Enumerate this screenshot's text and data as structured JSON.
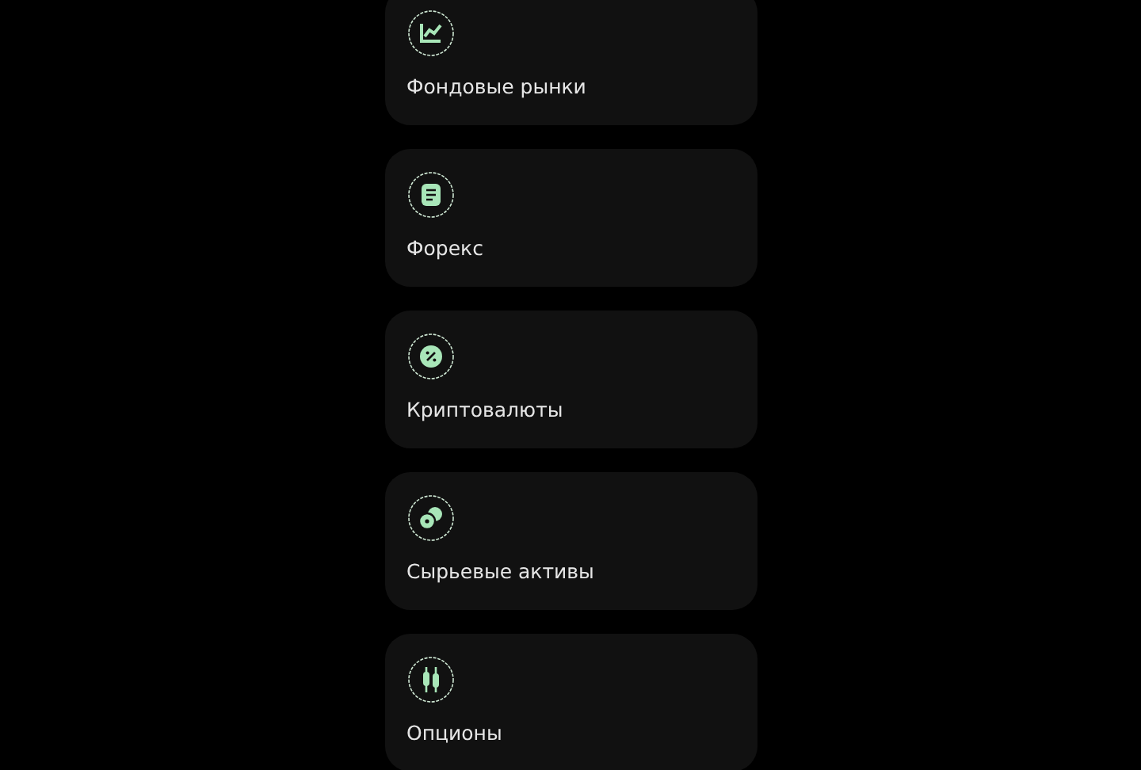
{
  "markets": [
    {
      "kind": "chart",
      "label": "Фондовые рынки"
    },
    {
      "kind": "document",
      "label": "Форекс"
    },
    {
      "kind": "percent",
      "label": "Криптовалюты"
    },
    {
      "kind": "coins",
      "label": "Сырьевые активы"
    },
    {
      "kind": "candles",
      "label": "Опционы"
    }
  ]
}
